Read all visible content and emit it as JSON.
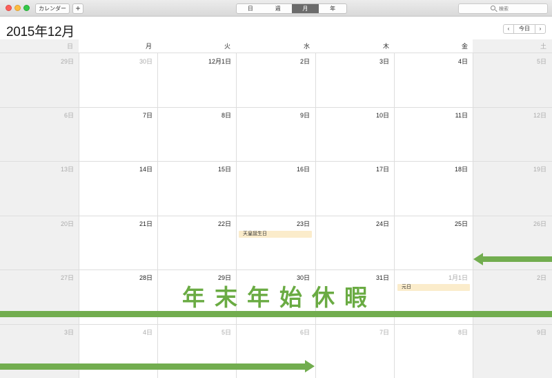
{
  "toolbar": {
    "calendars_label": "カレンダー",
    "add_label": "+",
    "views": [
      "日",
      "週",
      "月",
      "年"
    ],
    "active_view": "月",
    "search_placeholder": "検索"
  },
  "header": {
    "title": "2015年12月",
    "prev": "‹",
    "today": "今日",
    "next": "›"
  },
  "weekdays": [
    "日",
    "月",
    "火",
    "水",
    "木",
    "金",
    "土"
  ],
  "weeks": [
    [
      "29日",
      "30日",
      "12月1日",
      "2日",
      "3日",
      "4日",
      "5日"
    ],
    [
      "6日",
      "7日",
      "8日",
      "9日",
      "10日",
      "11日",
      "12日"
    ],
    [
      "13日",
      "14日",
      "15日",
      "16日",
      "17日",
      "18日",
      "19日"
    ],
    [
      "20日",
      "21日",
      "22日",
      "23日",
      "24日",
      "25日",
      "26日"
    ],
    [
      "27日",
      "28日",
      "29日",
      "30日",
      "31日",
      "1月1日",
      "2日"
    ],
    [
      "3日",
      "4日",
      "5日",
      "6日",
      "7日",
      "8日",
      "9日"
    ]
  ],
  "events": {
    "emperor_birthday": "天皇誕生日",
    "new_year": "元日"
  },
  "overlay": {
    "banner": "年末年始休暇"
  },
  "colors": {
    "accent_green": "#72ad4f",
    "event_bg": "#fbeccb",
    "weekend_bg": "#f0f0f0"
  }
}
